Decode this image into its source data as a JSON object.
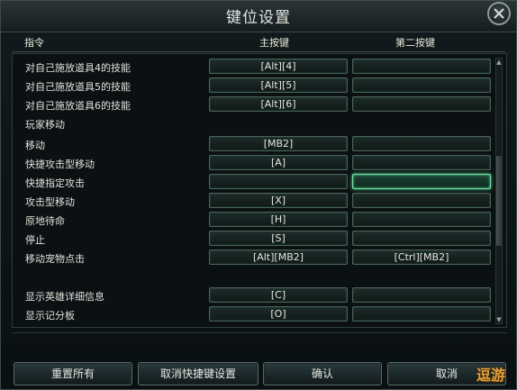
{
  "window": {
    "title": "键位设置"
  },
  "header": {
    "command": "指令",
    "primary": "主按键",
    "secondary": "第二按键"
  },
  "rows": [
    {
      "label": "对自己施放道具4的技能",
      "primary": "[Alt][4]",
      "secondary": ""
    },
    {
      "label": "对自己施放道具5的技能",
      "primary": "[Alt][5]",
      "secondary": ""
    },
    {
      "label": "对自己施放道具6的技能",
      "primary": "[Alt][6]",
      "secondary": ""
    },
    {
      "label": "玩家移动",
      "section": true
    },
    {
      "label": "移动",
      "primary": "[MB2]",
      "secondary": ""
    },
    {
      "label": "快捷攻击型移动",
      "primary": "[A]",
      "secondary": ""
    },
    {
      "label": "快捷指定攻击",
      "primary": "",
      "secondary": "",
      "highlight": true
    },
    {
      "label": "攻击型移动",
      "primary": "[X]",
      "secondary": ""
    },
    {
      "label": "原地待命",
      "primary": "[H]",
      "secondary": ""
    },
    {
      "label": "停止",
      "primary": "[S]",
      "secondary": ""
    },
    {
      "label": "移动宠物点击",
      "primary": "[Alt][MB2]",
      "secondary": "[Ctrl][MB2]"
    },
    {
      "label": "",
      "section": true
    },
    {
      "label": "显示英雄详细信息",
      "primary": "[C]",
      "secondary": ""
    },
    {
      "label": "显示记分板",
      "primary": "[O]",
      "secondary": ""
    }
  ],
  "buttons": {
    "reset": "重置所有",
    "cancel_key": "取消快捷键设置",
    "confirm": "确认",
    "cancel": "取消"
  },
  "watermark": "逗游",
  "icons": {
    "close": "close-icon"
  }
}
